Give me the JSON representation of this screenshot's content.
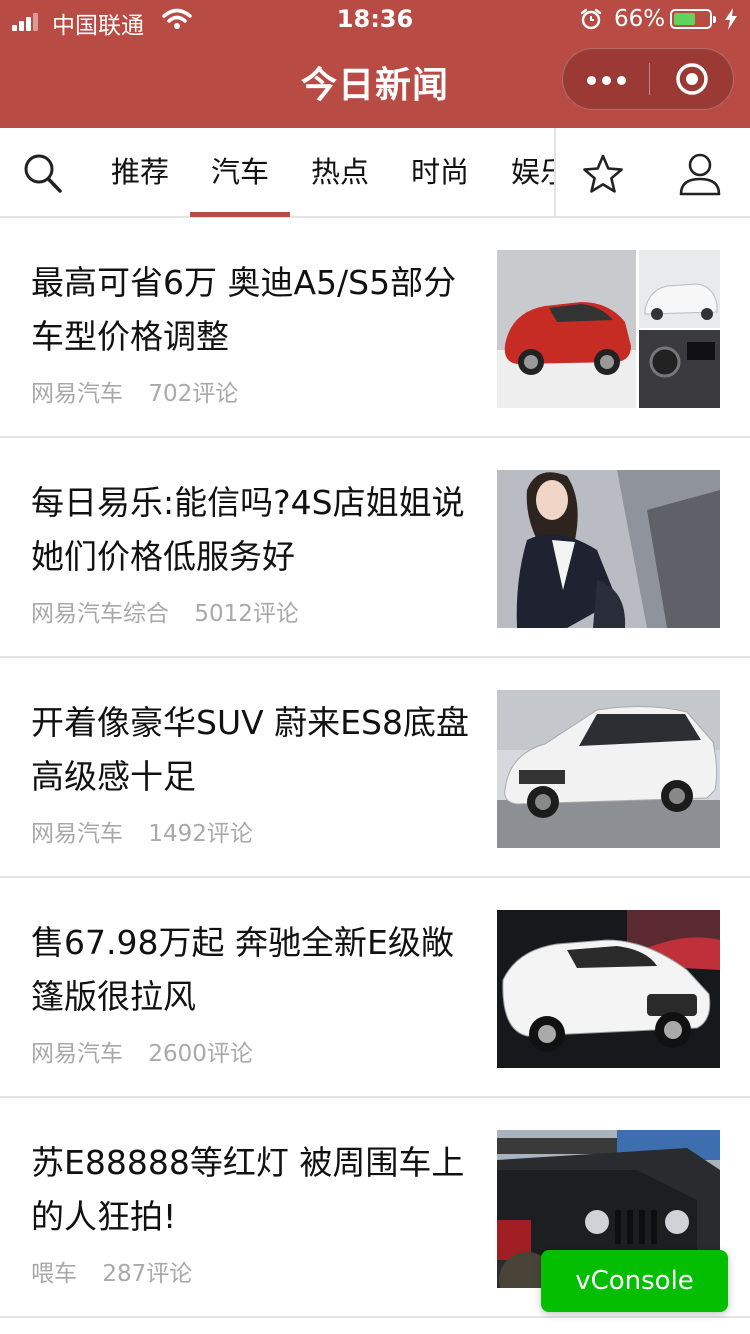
{
  "status_bar": {
    "carrier": "中国联通",
    "time": "18:36",
    "battery_percent": "66%",
    "battery_level": 0.66,
    "icons": [
      "signal-icon",
      "wifi-icon",
      "alarm-icon",
      "battery-icon",
      "charging-icon"
    ]
  },
  "nav": {
    "title": "今日新闻",
    "icons": [
      "more-icon",
      "close-target-icon"
    ]
  },
  "tabs": {
    "items": [
      "推荐",
      "汽车",
      "热点",
      "时尚",
      "娱乐"
    ],
    "active": "汽车",
    "icons": [
      "search-icon",
      "star-icon",
      "user-icon"
    ]
  },
  "news": [
    {
      "title": "最高可省6万 奥迪A5/S5部分车型价格调整",
      "source": "网易汽车",
      "comments": "702评论",
      "image": "red-sedan-photo"
    },
    {
      "title": "每日易乐:能信吗?4S店姐姐说她们价格低服务好",
      "source": "网易汽车综合",
      "comments": "5012评论",
      "image": "woman-photo"
    },
    {
      "title": "开着像豪华SUV 蔚来ES8底盘高级感十足",
      "source": "网易汽车",
      "comments": "1492评论",
      "image": "white-suv-photo"
    },
    {
      "title": "售67.98万起 奔驰全新E级敞篷版很拉风",
      "source": "网易汽车",
      "comments": "2600评论",
      "image": "white-convertible-photo"
    },
    {
      "title": "苏E88888等红灯 被周围车上的人狂拍!",
      "source": "喂车",
      "comments": "287评论",
      "image": "black-jeep-photo"
    }
  ],
  "vconsole": {
    "label": "vConsole"
  },
  "colors": {
    "brand": "#b84c45",
    "vconsole": "#04be02",
    "meta_text": "#a9a9a9"
  }
}
